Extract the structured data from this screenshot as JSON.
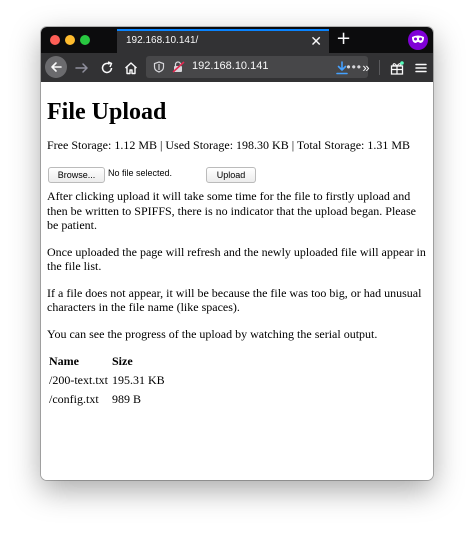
{
  "browser": {
    "tab_title": "192.168.10.141/",
    "tab_close": "✕",
    "new_tab": "+",
    "url": "192.168.10.141",
    "url_more": "•••",
    "overflow": "»",
    "accent_color": "#0a84ff",
    "private_color": "#8000d7"
  },
  "page": {
    "title": "File Upload",
    "storage": "Free Storage: 1.12 MB | Used Storage: 198.30 KB | Total Storage: 1.31 MB",
    "browse_label": "Browse...",
    "file_status": "No file selected.",
    "upload_label": "Upload",
    "paragraphs": [
      "After clicking upload it will take some time for the file to firstly upload and then be written to SPIFFS, there is no indicator that the upload began. Please be patient.",
      "Once uploaded the page will refresh and the newly uploaded file will appear in the file list.",
      "If a file does not appear, it will be because the file was too big, or had unusual characters in the file name (like spaces).",
      "You can see the progress of the upload by watching the serial output."
    ],
    "table": {
      "headers": [
        "Name",
        "Size"
      ],
      "rows": [
        [
          "/200-text.txt",
          "195.31 KB"
        ],
        [
          "/config.txt",
          "989 B"
        ]
      ]
    }
  },
  "icons": {
    "back": "arrow-left-icon",
    "forward": "arrow-right-icon",
    "reload": "reload-icon",
    "home": "home-icon",
    "shield": "shield-icon",
    "lock": "insecure-lock-icon",
    "download": "download-icon",
    "extensions": "extensions-icon",
    "menu": "hamburger-menu-icon",
    "private": "private-browsing-mask-icon"
  }
}
